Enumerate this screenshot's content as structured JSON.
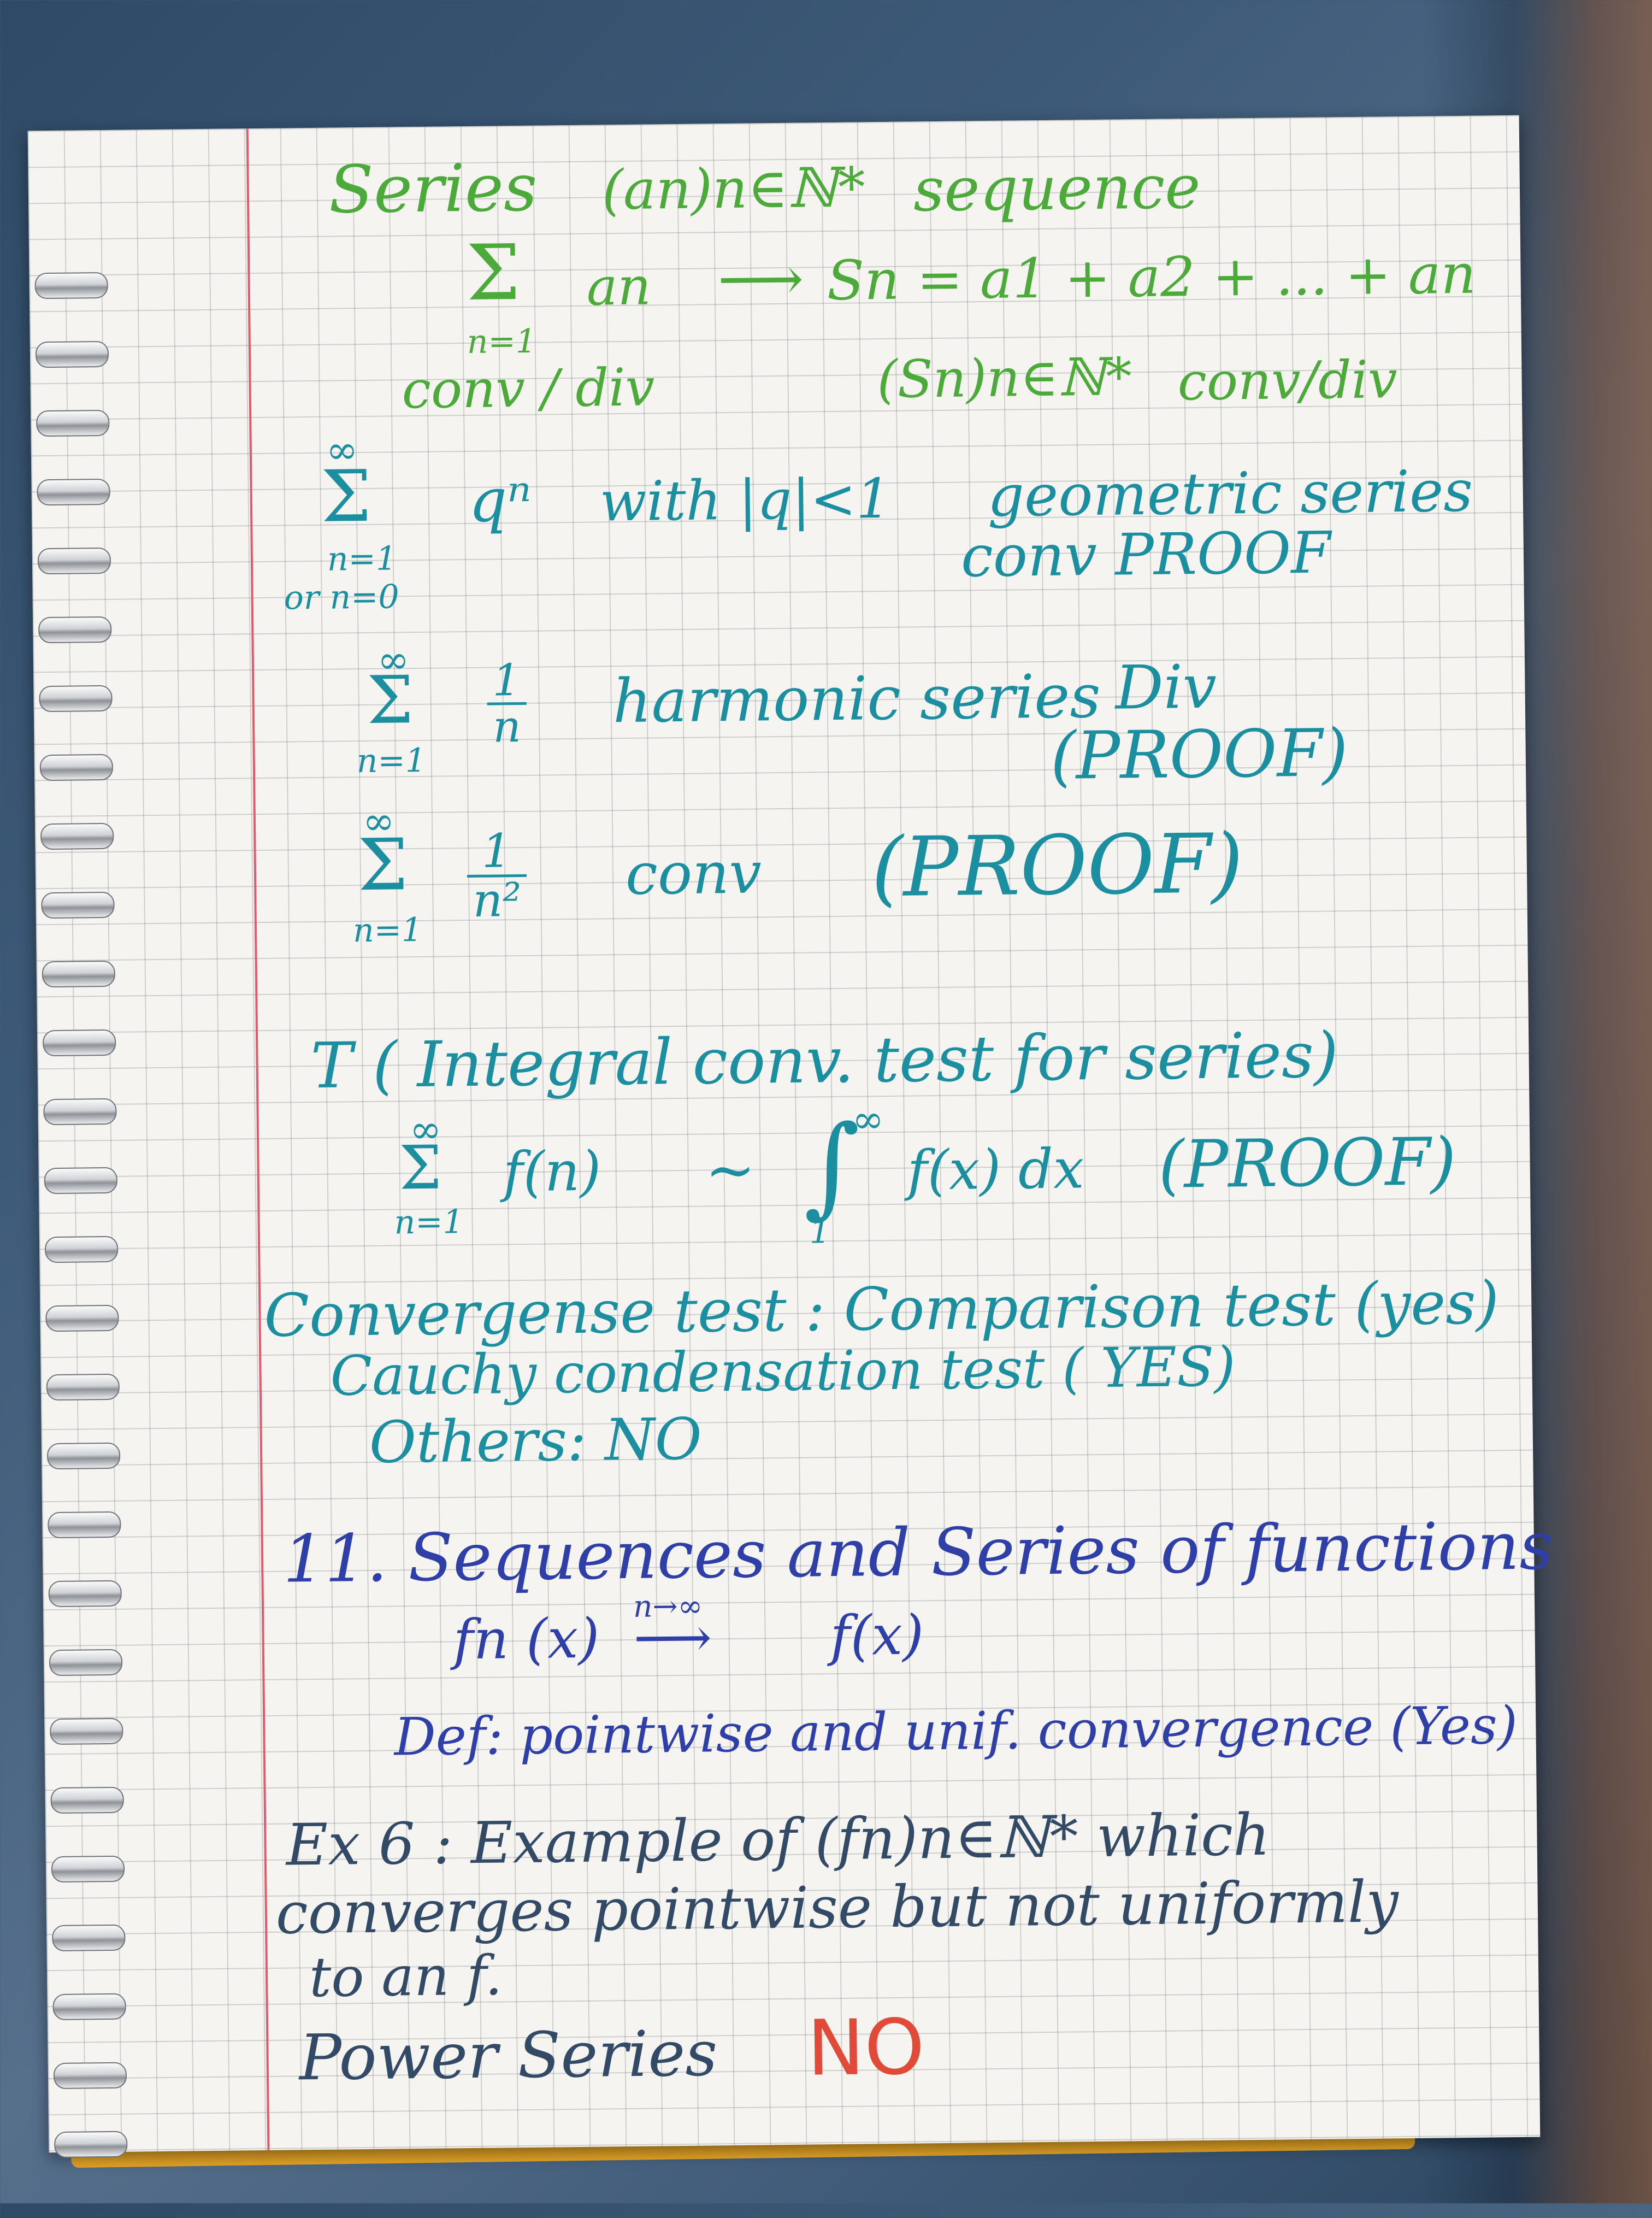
{
  "line1": {
    "a": "Series",
    "b": "(an)n∈ℕ*",
    "c": "sequence"
  },
  "line2": {
    "sigma": "Σ",
    "sub": "n=1",
    "a": "an",
    "arrow": "⟶",
    "b": "Sn = a1 + a2 + ... + an"
  },
  "line3": {
    "a": "conv / div",
    "b": "(Sn)n∈ℕ*",
    "c": "conv/div"
  },
  "geo": {
    "sup": "∞",
    "sigma": "Σ",
    "sub1": "n=1",
    "sub2": "or n=0",
    "a": "qⁿ",
    "b": "with |q|<1",
    "c": "geometric series",
    "d": "conv PROOF"
  },
  "harm": {
    "sup": "∞",
    "sigma": "Σ",
    "sub": "n=1",
    "num": "1",
    "den": "n",
    "a": "harmonic series",
    "b": "Div",
    "c": "(PROOF)"
  },
  "inv2": {
    "sup": "∞",
    "sigma": "Σ",
    "sub": "n=1",
    "num": "1",
    "den": "n²",
    "a": "conv",
    "b": "(PROOF)"
  },
  "integral": {
    "title": "T ( Integral conv. test for series)",
    "sup": "∞",
    "sigma": "Σ",
    "sub": "n=1",
    "fn": "f(n)",
    "sim": "∼",
    "int": "∫",
    "int_sup": "∞",
    "int_sub": "1",
    "fx": "f(x) dx",
    "proof": "(PROOF)"
  },
  "conv": {
    "a": "Convergense test : Comparison test (yes)",
    "b": "Cauchy condensation test ( YES)",
    "c": "Others: NO"
  },
  "sec11": {
    "title": "11. Sequences and Series of functions",
    "limit": "fn (x)",
    "arrow": "⟶",
    "arrow_label": "n→∞",
    "fx": "f(x)",
    "def": "Def: pointwise and unif. convergence (Yes)"
  },
  "ex6": {
    "a": "Ex 6 : Example of (fn)n∈ℕ* which",
    "b": "converges pointwise but not uniformly",
    "c": "to an f."
  },
  "power": {
    "a": "Power Series",
    "b": "NO"
  }
}
